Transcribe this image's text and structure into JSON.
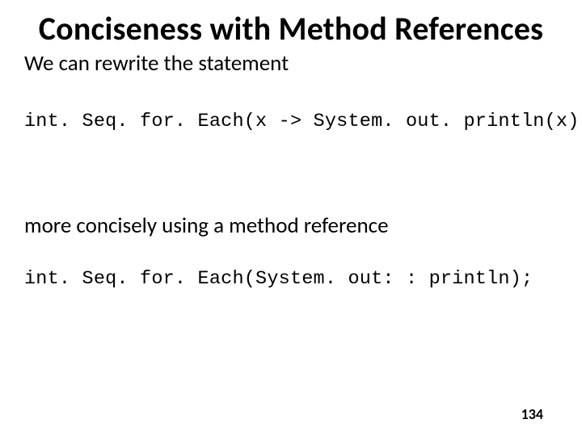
{
  "title": "Conciseness with Method References",
  "intro": "We can rewrite the statement",
  "code_lambda": "int. Seq. for. Each(x -> System. out. println(x));",
  "body2": "more concisely using a method reference",
  "code_methodref": "int. Seq. for. Each(System. out: : println);",
  "page_number": "134"
}
